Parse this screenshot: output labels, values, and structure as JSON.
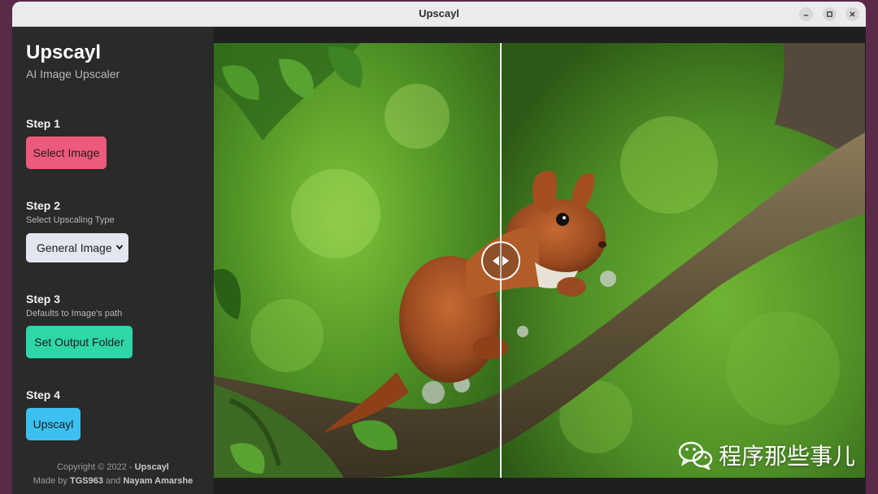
{
  "window": {
    "title": "Upscayl"
  },
  "app": {
    "name": "Upscayl",
    "subtitle": "AI Image Upscaler"
  },
  "steps": [
    {
      "title": "Step 1",
      "button": "Select Image"
    },
    {
      "title": "Step 2",
      "subtitle": "Select Upscaling Type",
      "select_value": "General Image"
    },
    {
      "title": "Step 3",
      "subtitle": "Defaults to Image's path",
      "button": "Set Output Folder"
    },
    {
      "title": "Step 4",
      "button": "Upscayl"
    }
  ],
  "footer": {
    "copyright": "Copyright © 2022 -",
    "brand": "Upscayl",
    "made_by": "Made by",
    "author1": "TGS963",
    "and": "and",
    "author2": "Nayam Amarshe"
  },
  "watermark": {
    "text": "程序那些事儿"
  },
  "colors": {
    "select_image_btn": "#ee5a7b",
    "output_folder_btn": "#2ed6a8",
    "upscayl_btn": "#3cc0f0",
    "sidebar_bg": "#2b2a2a",
    "desktop_bg": "#5a2a48"
  },
  "icons": [
    "minimize-icon",
    "maximize-icon",
    "close-icon",
    "compare-slider-icon",
    "wechat-icon",
    "chevron-down-icon"
  ]
}
